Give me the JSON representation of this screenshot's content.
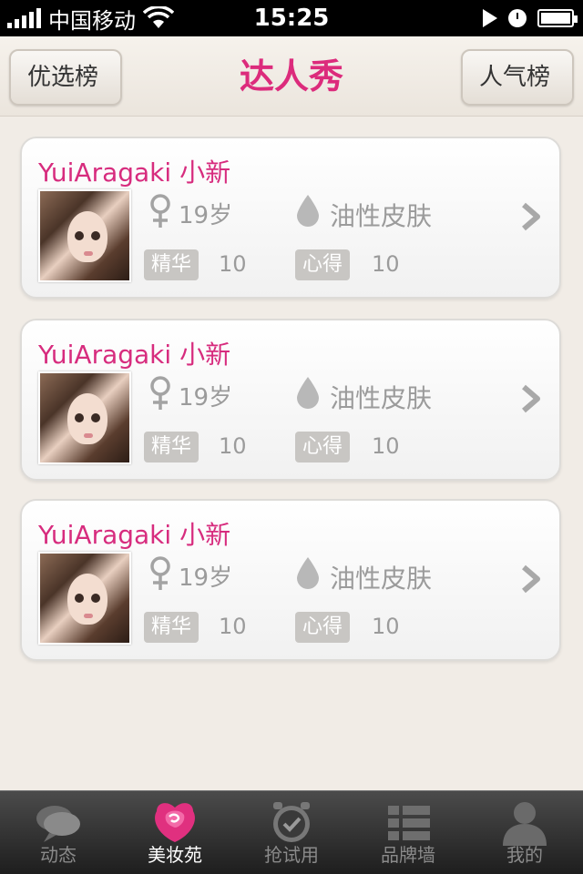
{
  "status_bar": {
    "carrier": "中国移动",
    "time": "15:25"
  },
  "nav": {
    "title": "达人秀",
    "left_button": "优选榜",
    "right_button": "人气榜"
  },
  "cards": [
    {
      "name": "YuiAragaki 小新",
      "age": "19岁",
      "skin": "油性皮肤",
      "tag_a_label": "精华",
      "tag_a_count": "10",
      "tag_b_label": "心得",
      "tag_b_count": "10"
    },
    {
      "name": "YuiAragaki 小新",
      "age": "19岁",
      "skin": "油性皮肤",
      "tag_a_label": "精华",
      "tag_a_count": "10",
      "tag_b_label": "心得",
      "tag_b_count": "10"
    },
    {
      "name": "YuiAragaki 小新",
      "age": "19岁",
      "skin": "油性皮肤",
      "tag_a_label": "精华",
      "tag_a_count": "10",
      "tag_b_label": "心得",
      "tag_b_count": "10"
    }
  ],
  "tabs": [
    {
      "label": "动态",
      "icon": "chat-bubbles-icon",
      "active": false
    },
    {
      "label": "美妆苑",
      "icon": "rose-icon",
      "active": true
    },
    {
      "label": "抢试用",
      "icon": "alarm-clock-icon",
      "active": false
    },
    {
      "label": "品牌墙",
      "icon": "list-icon",
      "active": false
    },
    {
      "label": "我的",
      "icon": "person-icon",
      "active": false
    }
  ],
  "colors": {
    "accent": "#dc2b7c",
    "background": "#f1ece6",
    "tabbar": "#2e2e2e"
  }
}
